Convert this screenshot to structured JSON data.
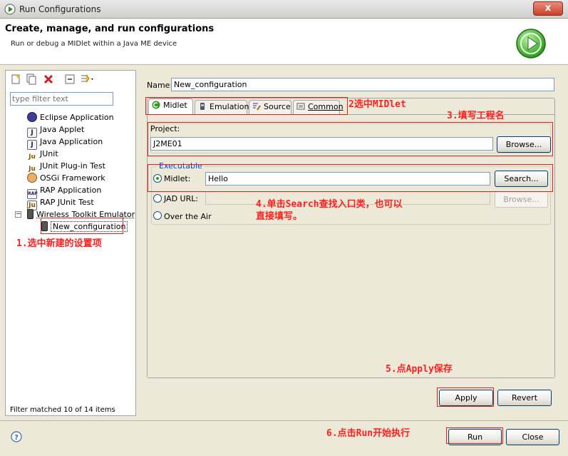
{
  "window": {
    "title": "Run Configurations",
    "close_label": "x"
  },
  "header": {
    "title": "Create, manage, and run configurations",
    "subtitle": "Run or debug a MIDlet within a Java ME device"
  },
  "left": {
    "filter_placeholder": "type filter text",
    "tree": [
      {
        "label": "Eclipse Application",
        "icon": "eclipse-app-icon"
      },
      {
        "label": "Java Applet",
        "icon": "java-applet-icon"
      },
      {
        "label": "Java Application",
        "icon": "java-app-icon"
      },
      {
        "label": "JUnit",
        "icon": "junit-icon"
      },
      {
        "label": "JUnit Plug-in Test",
        "icon": "junit-plugin-icon"
      },
      {
        "label": "OSGi Framework",
        "icon": "osgi-icon"
      },
      {
        "label": "RAP Application",
        "icon": "rap-app-icon"
      },
      {
        "label": "RAP JUnit Test",
        "icon": "rap-junit-icon"
      },
      {
        "label": "Wireless Toolkit Emulator",
        "icon": "wireless-emulator-icon"
      },
      {
        "label": "New_configuration",
        "icon": "phone-icon"
      }
    ],
    "filter_status": "Filter matched 10 of 14 items"
  },
  "right": {
    "name_label": "Name:",
    "name_value": "New_configuration",
    "tabs": [
      "Midlet",
      "Emulation",
      "Source",
      "Common"
    ],
    "project_label": "Project:",
    "project_value": "J2ME01",
    "browse_label": "Browse...",
    "executable_label": "Executable",
    "midlet_label": "Midlet:",
    "midlet_value": "Hello",
    "search_label": "Search...",
    "jad_label": "JAD URL:",
    "jad_browse_label": "Browse...",
    "ota_label": "Over the Air",
    "apply_label": "Apply",
    "revert_label": "Revert"
  },
  "footer": {
    "run_label": "Run",
    "close_label": "Close"
  },
  "annotations": {
    "a1": "1.选中新建的设置项",
    "a2": "2选中MIDlet",
    "a3": "3.填写工程名",
    "a4_line1": "4.单击Search查找入口类，也可以",
    "a4_line2": "直接填写。",
    "a5": "5.点Apply保存",
    "a6": "6.点击Run开始执行"
  },
  "colors": {
    "annotation": "#ff2020",
    "group_title": "#0046d5"
  }
}
